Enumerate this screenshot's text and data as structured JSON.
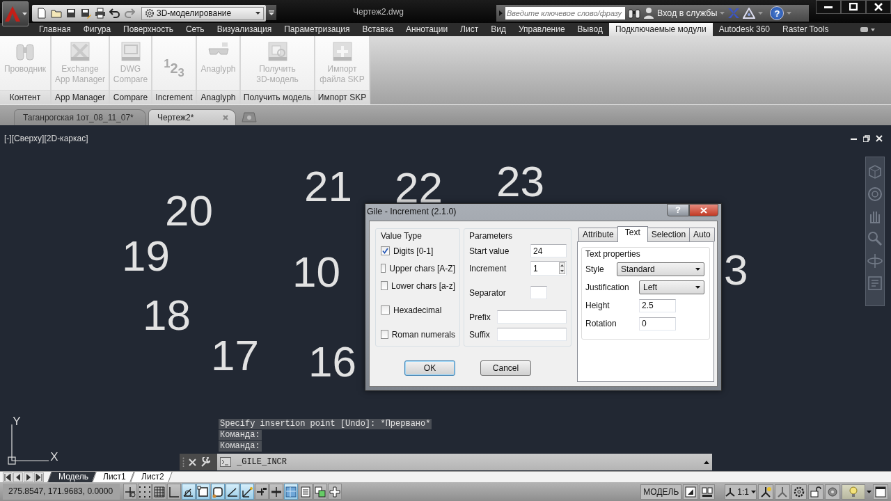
{
  "title_bar": {
    "workspace": "3D-моделирование",
    "document_title": "Чертеж2.dwg",
    "search": {
      "placeholder": "Введите ключевое слово/фразу"
    },
    "sign_in": "Вход в службы",
    "help": "?"
  },
  "ribbon_tabs": [
    {
      "label": "Главная",
      "selected": false
    },
    {
      "label": "Фигура",
      "selected": false
    },
    {
      "label": "Поверхность",
      "selected": false
    },
    {
      "label": "Сеть",
      "selected": false
    },
    {
      "label": "Визуализация",
      "selected": false
    },
    {
      "label": "Параметризация",
      "selected": false
    },
    {
      "label": "Вставка",
      "selected": false
    },
    {
      "label": "Аннотации",
      "selected": false
    },
    {
      "label": "Лист",
      "selected": false
    },
    {
      "label": "Вид",
      "selected": false
    },
    {
      "label": "Управление",
      "selected": false
    },
    {
      "label": "Вывод",
      "selected": false
    },
    {
      "label": "Подключаемые модули",
      "selected": true
    },
    {
      "label": "Autodesk 360",
      "selected": false
    },
    {
      "label": "Raster Tools",
      "selected": false
    }
  ],
  "ribbon_panels": [
    {
      "kind": "binoculars",
      "tool": "Проводник",
      "title": "Контент",
      "disabled": true
    },
    {
      "kind": "exchange",
      "tool": "Exchange\nApp Manager",
      "title": "App Manager",
      "disabled": true
    },
    {
      "kind": "compare",
      "tool": "DWG\nCompare",
      "title": "Compare",
      "disabled": true
    },
    {
      "kind": "glyph",
      "glyph": "$^{1}$2$_{3}$",
      "title": "Increment",
      "disabled": true
    },
    {
      "kind": "glasses",
      "tool": "Anaglyph",
      "title": "Anaglyph",
      "disabled": true
    },
    {
      "kind": "model",
      "tool": "Получить\n3D-модель",
      "title": "Получить модель",
      "disabled": true
    },
    {
      "kind": "import",
      "tool": "Импорт\nфайла SKP",
      "title": "Импорт SKP",
      "disabled": true
    }
  ],
  "document_tabs": [
    {
      "label": "Таганрогская 1от_08_11_07*",
      "selected": false
    },
    {
      "label": "Чертеж2*",
      "selected": true
    }
  ],
  "viewport": {
    "label": "[-][Сверху][2D-каркас]",
    "numbers": [
      "20",
      "21",
      "22",
      "23",
      "19",
      "10",
      "18",
      "17",
      "16",
      "3"
    ],
    "ucs": {
      "x": "X",
      "y": "Y"
    }
  },
  "dialog": {
    "title": "Gile - Increment (2.1.0)",
    "help": "?",
    "value_type": {
      "label": "Value Type",
      "options": [
        {
          "label": "Digits [0-1]",
          "checked": true
        },
        {
          "label": "Upper chars [A-Z]",
          "checked": false
        },
        {
          "label": "Lower chars [a-z]",
          "checked": false
        },
        {
          "label": "Hexadecimal",
          "checked": false
        },
        {
          "label": "Roman numerals",
          "checked": false
        }
      ]
    },
    "parameters": {
      "label": "Parameters",
      "fields": [
        {
          "kind": "number",
          "label": "Start value",
          "value": "24"
        },
        {
          "kind": "spinner",
          "label": "Increment",
          "value": "1"
        },
        {
          "kind": "short",
          "label": "Separator"
        },
        {
          "kind": "wide",
          "label": "Prefix"
        },
        {
          "kind": "wide",
          "label": "Suffix"
        }
      ]
    },
    "tabs": [
      {
        "label": "Attribute",
        "selected": false
      },
      {
        "label": "Text",
        "selected": true
      },
      {
        "label": "Selection",
        "selected": false
      },
      {
        "label": "Auto",
        "selected": false
      }
    ],
    "text_properties": {
      "label": "Text properties",
      "fields": [
        {
          "kind": "wide-dropdown",
          "label": "Style",
          "value": "Standard"
        },
        {
          "kind": "dropdown",
          "label": "Justification",
          "value": "Left"
        },
        {
          "kind": "text",
          "label": "Height",
          "value": "2.5"
        },
        {
          "kind": "text",
          "label": "Rotation",
          "value": "0"
        }
      ]
    },
    "buttons": [
      {
        "label": "OK",
        "default": true
      },
      {
        "label": "Cancel",
        "default": false
      }
    ]
  },
  "command_line": {
    "history": [
      "Specify insertion point [Undo]: *Прервано*",
      "Команда:",
      "Команда:"
    ],
    "input": "_GILE_INCR"
  },
  "layout_tabs": [
    {
      "label": "Модель",
      "selected": true
    },
    {
      "label": "Лист1",
      "selected": false
    },
    {
      "label": "Лист2",
      "selected": false
    }
  ],
  "status_bar": {
    "coordinates": "275.8547, 171.9683, 0.0000",
    "toggles": [
      {
        "kind": "infer",
        "on": false
      },
      {
        "kind": "snap",
        "on": false
      },
      {
        "kind": "grid",
        "on": false
      },
      {
        "kind": "ortho",
        "on": false
      },
      {
        "kind": "polar",
        "on": true
      },
      {
        "kind": "osnap",
        "on": true
      },
      {
        "kind": "osnap3d",
        "on": true
      },
      {
        "kind": "otrack",
        "on": true
      },
      {
        "kind": "ducs",
        "on": true
      },
      {
        "kind": "dyn",
        "on": false
      },
      {
        "kind": "lweight",
        "on": false
      },
      {
        "kind": "transparency",
        "on": true
      },
      {
        "kind": "qprops",
        "on": false
      },
      {
        "kind": "cycle",
        "on": false
      },
      {
        "kind": "gizmo",
        "on": false
      }
    ],
    "model": "МОДЕЛЬ",
    "scale": "1:1"
  }
}
